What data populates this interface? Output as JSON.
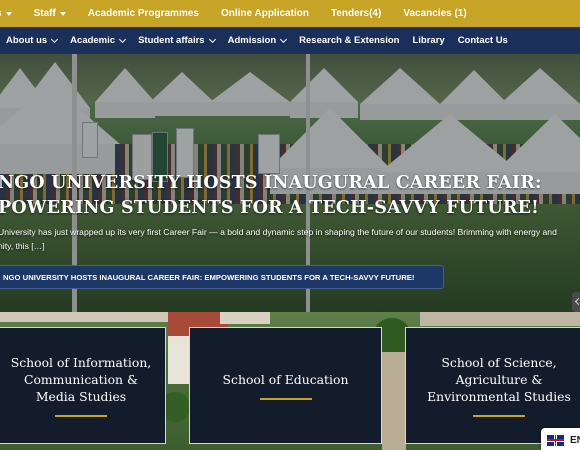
{
  "topbar": {
    "items": [
      {
        "label": "s",
        "has_caret": true
      },
      {
        "label": "Staff",
        "has_caret": true
      },
      {
        "label": "Academic Programmes",
        "has_caret": false
      },
      {
        "label": "Online Application",
        "has_caret": false
      },
      {
        "label": "Tenders(4)",
        "has_caret": false
      },
      {
        "label": "Vacancies (1)",
        "has_caret": false
      }
    ]
  },
  "nav": {
    "items": [
      {
        "label": "About us",
        "has_dropdown": true
      },
      {
        "label": "Academic",
        "has_dropdown": true
      },
      {
        "label": "Student affairs",
        "has_dropdown": true
      },
      {
        "label": "Admission",
        "has_dropdown": true
      },
      {
        "label": "Research & Extension",
        "has_dropdown": false
      },
      {
        "label": "Library",
        "has_dropdown": false
      },
      {
        "label": "Contact Us",
        "has_dropdown": false
      }
    ]
  },
  "hero": {
    "title_line1": "NGO UNIVERSITY HOSTS INAUGURAL CAREER FAIR:",
    "title_line2": "POWERING STUDENTS FOR A TECH-SAVVY FUTURE!",
    "excerpt_line1": "University has just wrapped up its very first Career Fair — a bold and dynamic step in shaping the future of our students! Brimming with energy and",
    "excerpt_line2": "nity, this […]",
    "button_label": "NGO UNIVERSITY HOSTS INAUGURAL CAREER FAIR: EMPOWERING STUDENTS FOR A TECH-SAVVY FUTURE!"
  },
  "cards": [
    {
      "title": "School of Information, Communication & Media Studies"
    },
    {
      "title": "School of Education"
    },
    {
      "title": "School of Science, Agriculture & Environmental Studies"
    }
  ],
  "language": {
    "code": "EN",
    "icon": "uk-flag-icon"
  },
  "colors": {
    "topbar": "#c8a426",
    "nav": "#1a2f5a",
    "card_bg": "#131c2b",
    "accent_line": "#c8a426"
  }
}
